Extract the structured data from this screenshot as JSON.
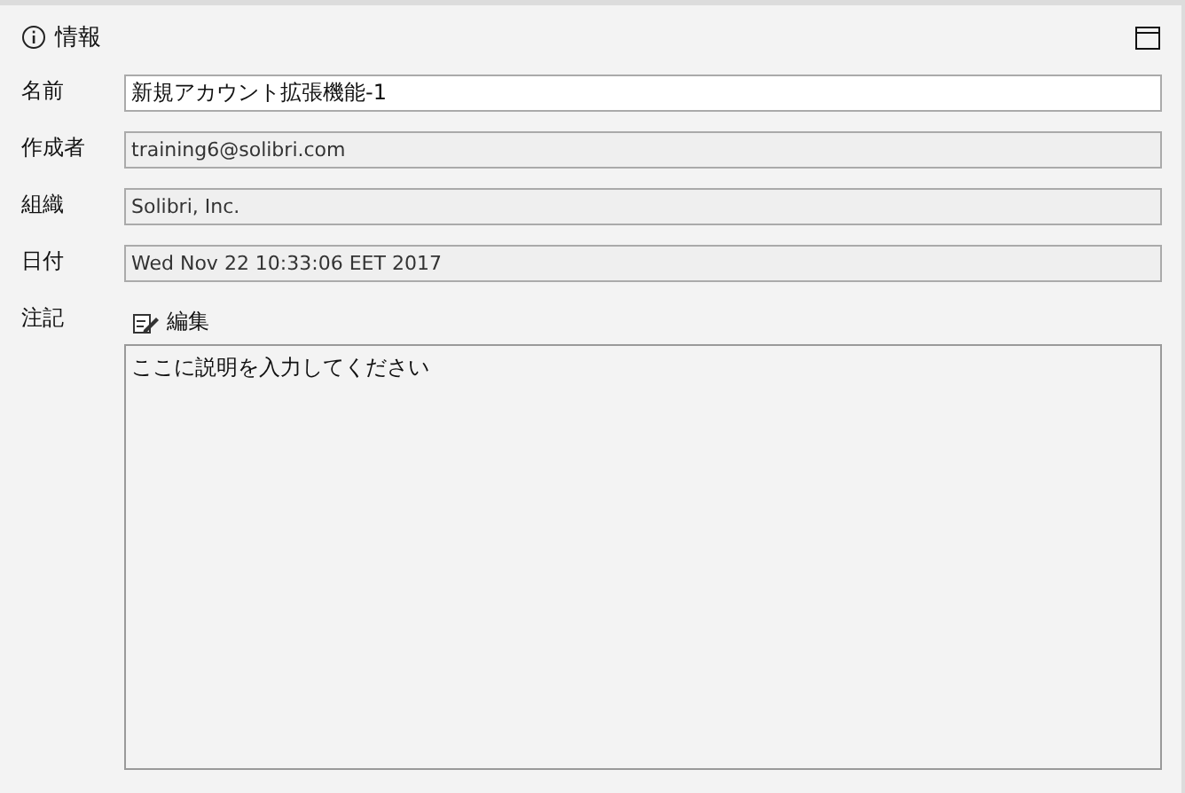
{
  "panel": {
    "title": "情報"
  },
  "fields": [
    {
      "label": "名前",
      "value": "新規アカウント拡張機能-1",
      "readonly": false
    },
    {
      "label": "作成者",
      "value": "training6@solibri.com",
      "readonly": true
    },
    {
      "label": "組織",
      "value": "Solibri, Inc.",
      "readonly": true
    },
    {
      "label": "日付",
      "value": "Wed Nov 22 10:33:06 EET 2017",
      "readonly": true
    }
  ],
  "notes": {
    "label": "注記",
    "edit_button": "編集",
    "value": "ここに説明を入力してください"
  }
}
